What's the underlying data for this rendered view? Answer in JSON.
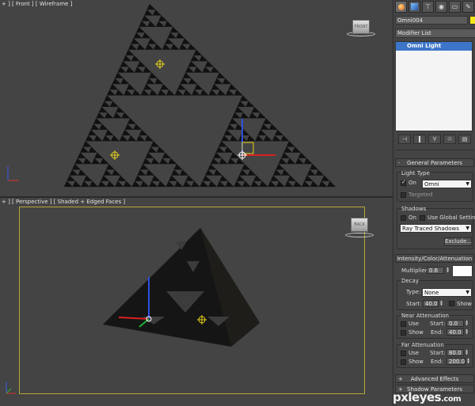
{
  "viewports": {
    "front": {
      "label": "+ ] [ Front ] [ Wireframe ]",
      "viewcube_label": "FRONT"
    },
    "perspective": {
      "label": "+ ] [ Perspective ] [ Shaded + Edged Faces ]",
      "viewcube_label": "BACK"
    }
  },
  "command_panel": {
    "tabs": [
      {
        "icon": "sphere-create-icon",
        "active": true
      },
      {
        "icon": "modify-icon",
        "active": false
      },
      {
        "icon": "hierarchy-icon",
        "active": false
      },
      {
        "icon": "motion-icon",
        "active": false
      },
      {
        "icon": "display-icon",
        "active": false
      },
      {
        "icon": "utilities-icon",
        "active": false
      }
    ],
    "object_name": "Omni004",
    "object_color": "#f2e61a",
    "modifier_list": "Modifier List",
    "stack_item": "Omni Light"
  },
  "general_parameters": {
    "header": "General Parameters",
    "light_type": {
      "title": "Light Type",
      "on_label": "On",
      "type_value": "Omni",
      "targeted_label": "Targeted"
    },
    "shadows": {
      "title": "Shadows",
      "on_label": "On",
      "global_label": "Use Global Settings",
      "type_value": "Ray Traced Shadows",
      "exclude_label": "Exclude..."
    }
  },
  "intensity": {
    "header": "Intensity/Color/Attenuation",
    "multiplier_label": "Multiplier:",
    "multiplier_value": "0.6",
    "color": "#ffffff",
    "decay": {
      "title": "Decay",
      "type_label": "Type:",
      "type_value": "None",
      "start_label": "Start:",
      "start_value": "40.0",
      "show_label": "Show"
    },
    "near": {
      "title": "Near Attenuation",
      "use_label": "Use",
      "start_label": "Start:",
      "start_value": "0.0",
      "show_label": "Show",
      "end_label": "End:",
      "end_value": "40.0"
    },
    "far": {
      "title": "Far Attenuation",
      "use_label": "Use",
      "start_label": "Start:",
      "start_value": "80.0",
      "show_label": "Show",
      "end_label": "End:",
      "end_value": "200.0"
    }
  },
  "advanced_effects": {
    "header": "Advanced Effects"
  },
  "shadow_parameters": {
    "header": "Shadow Parameters"
  },
  "watermark": {
    "main": "pxleyes",
    "suffix": ".com"
  }
}
